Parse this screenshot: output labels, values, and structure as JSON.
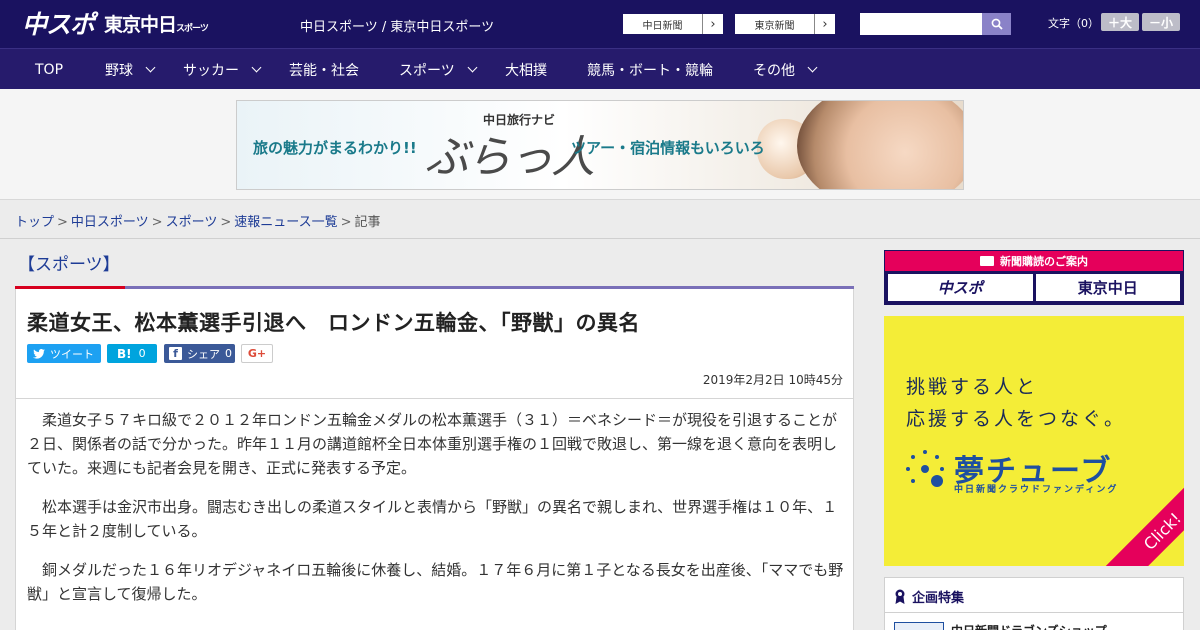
{
  "header": {
    "logo_primary": "中スポ",
    "logo_secondary": "東京中日",
    "logo_secondary_small": "スポーツ",
    "site_link": "中日スポーツ / 東京中日スポーツ",
    "ext_links": [
      {
        "label": "中日新聞",
        "arrow": "›"
      },
      {
        "label": "東京新聞",
        "arrow": "›"
      }
    ],
    "search": {
      "value": "",
      "icon": "search-icon"
    },
    "fontsize": {
      "label": "文字（0）",
      "bigger": "＋大",
      "smaller": "－小"
    }
  },
  "nav": {
    "items": [
      {
        "label": "TOP",
        "dropdown": false
      },
      {
        "label": "野球",
        "dropdown": true
      },
      {
        "label": "サッカー",
        "dropdown": true
      },
      {
        "label": "芸能・社会",
        "dropdown": false
      },
      {
        "label": "スポーツ",
        "dropdown": true
      },
      {
        "label": "大相撲",
        "dropdown": false
      },
      {
        "label": "競馬・ボート・競輪",
        "dropdown": false
      },
      {
        "label": "その他",
        "dropdown": true
      }
    ]
  },
  "ad_banner": {
    "left_copy": "旅の魅力がまるわかり!!",
    "top_copy": "中日旅行ナビ",
    "brand": "ぶらっ人",
    "right_copy": "ツアー・宿泊情報もいろいろ"
  },
  "breadcrumb": {
    "items": [
      "トップ",
      "中日スポーツ",
      "スポーツ",
      "速報ニュース一覧"
    ],
    "separator": ">",
    "current": "記事"
  },
  "article": {
    "category": "【スポーツ】",
    "headline": "柔道女王、松本薫選手引退へ　ロンドン五輪金、「野獣」の異名",
    "social": {
      "tweet": "ツイート",
      "hatena_icon": "B!",
      "hatena_count": "0",
      "share": "シェア",
      "share_count": "0",
      "gplus": "G+"
    },
    "date": "2019年2月2日 10時45分",
    "paragraphs": [
      "柔道女子５７キロ級で２０１２年ロンドン五輪金メダルの松本薫選手（３１）＝ベネシード＝が現役を引退することが２日、関係者の話で分かった。昨年１１月の講道館杯全日本体重別選手権の１回戦で敗退し、第一線を退く意向を表明していた。来週にも記者会見を開き、正式に発表する予定。",
      "松本選手は金沢市出身。闘志むき出しの柔道スタイルと表情から「野獣」の異名で親しまれ、世界選手権は１０年、１５年と計２度制している。",
      "銅メダルだった１６年リオデジャネイロ五輪後に休養し、結婚。１７年６月に第１子となる長女を出産後、「ママでも野獣」と宣言して復帰した。"
    ]
  },
  "sidebar": {
    "subscribe": {
      "title": "新聞購読のご案内",
      "logo_a": "中スポ",
      "logo_b": "東京中日"
    },
    "yume_ad": {
      "line1": "挑戦する人と",
      "line2": "応援する人をつなぐ。",
      "brand": "夢チューブ",
      "sub": "中日新聞クラウドファンディング",
      "click": "Click!"
    },
    "feature": {
      "title": "企画特集",
      "item": "中日新聞ドラゴンズショップ"
    }
  },
  "colors": {
    "header_bg": "#1a1260",
    "nav_bg": "#261b6c",
    "accent_red": "#d7001e",
    "link_blue": "#1e3c96",
    "yume_yellow": "#f4ed37"
  }
}
